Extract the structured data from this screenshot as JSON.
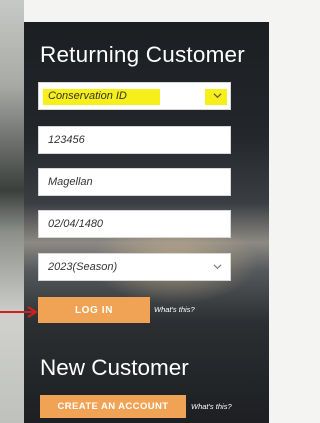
{
  "returning": {
    "title": "Returning Customer",
    "id_type": "Conservation ID",
    "id_number": "123456",
    "last_name": "Magellan",
    "dob": "02/04/1480",
    "season": "2023(Season)",
    "login_label": "LOG IN",
    "whats_this": "What's this?"
  },
  "newcust": {
    "title": "New Customer",
    "create_label": "CREATE AN ACCOUNT",
    "whats_this": "What's this?"
  },
  "colors": {
    "button": "#f0a255",
    "highlight": "#f7ef1a",
    "arrow": "#d0201d"
  },
  "icons": [
    "chevron-down-icon",
    "arrow-right-icon"
  ]
}
